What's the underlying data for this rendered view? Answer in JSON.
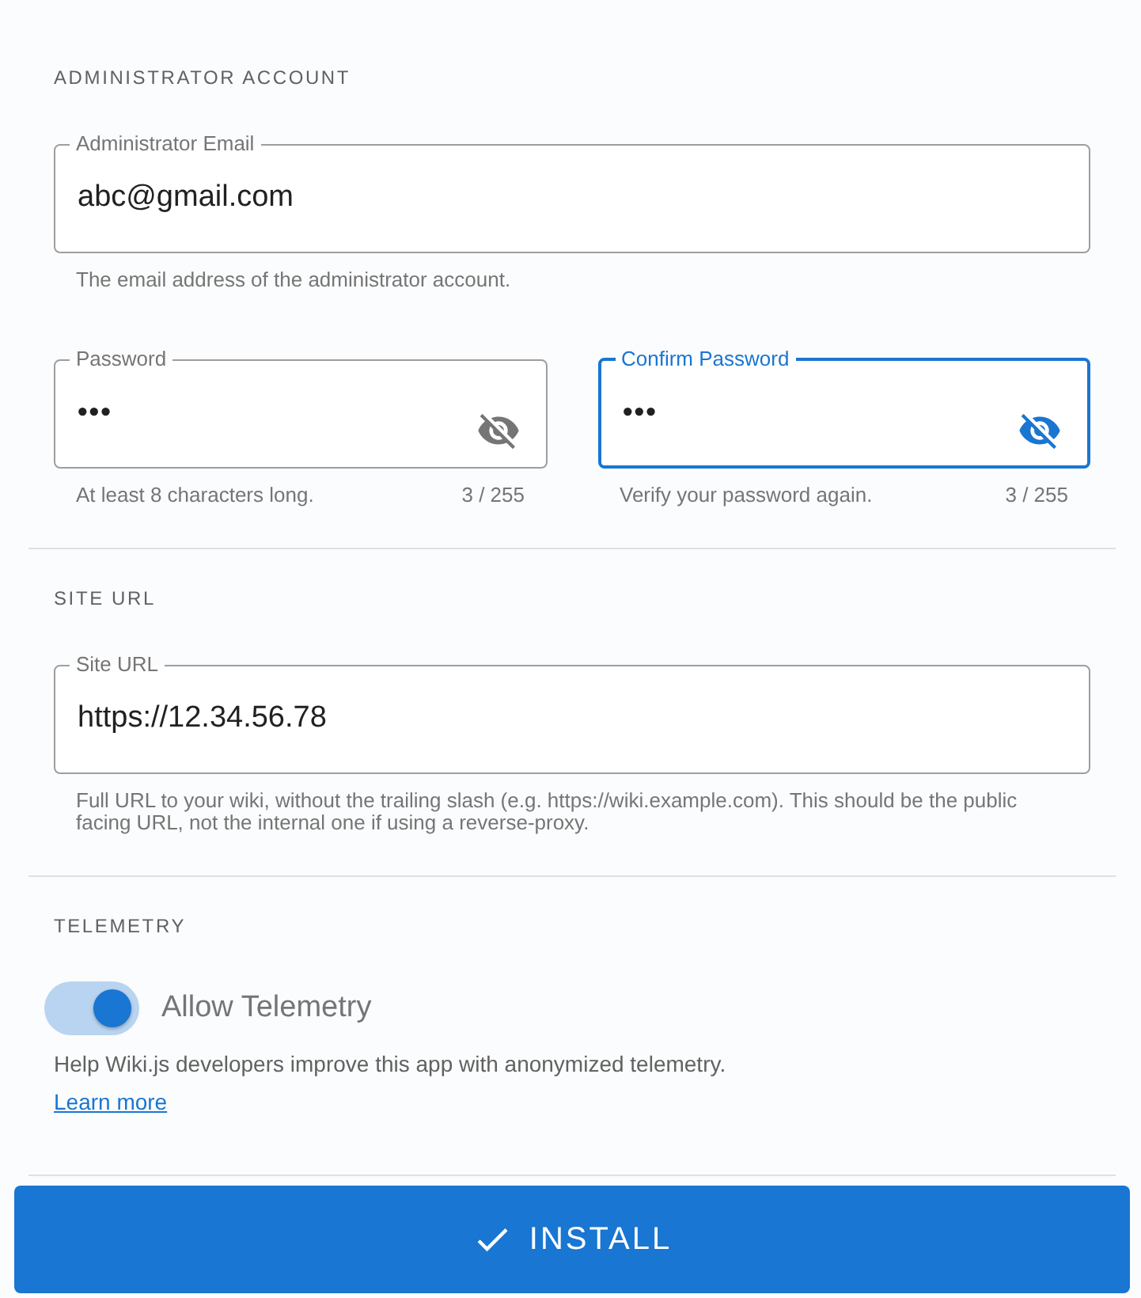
{
  "admin": {
    "heading": "ADMINISTRATOR ACCOUNT",
    "email": {
      "label": "Administrator Email",
      "value": "abc@gmail.com",
      "hint": "The email address of the administrator account.",
      "focused": false
    },
    "passwords": [
      {
        "label": "Password",
        "value": "•••",
        "hint": "At least 8 characters long.",
        "counter": "3 / 255",
        "focused": false
      },
      {
        "label": "Confirm Password",
        "value": "•••",
        "hint": "Verify your password again.",
        "counter": "3 / 255",
        "focused": true
      }
    ]
  },
  "site": {
    "heading": "SITE URL",
    "field": {
      "label": "Site URL",
      "value": "https://12.34.56.78",
      "hint": "Full URL to your wiki, without the trailing slash (e.g. https://wiki.example.com). This should be the public facing URL, not the internal one if using a reverse-proxy.",
      "focused": false
    }
  },
  "telemetry": {
    "heading": "TELEMETRY",
    "toggle": {
      "label": "Allow Telemetry",
      "on": true
    },
    "help": "Help Wiki.js developers improve this app with anonymized telemetry.",
    "link": "Learn more"
  },
  "install_button": "INSTALL"
}
